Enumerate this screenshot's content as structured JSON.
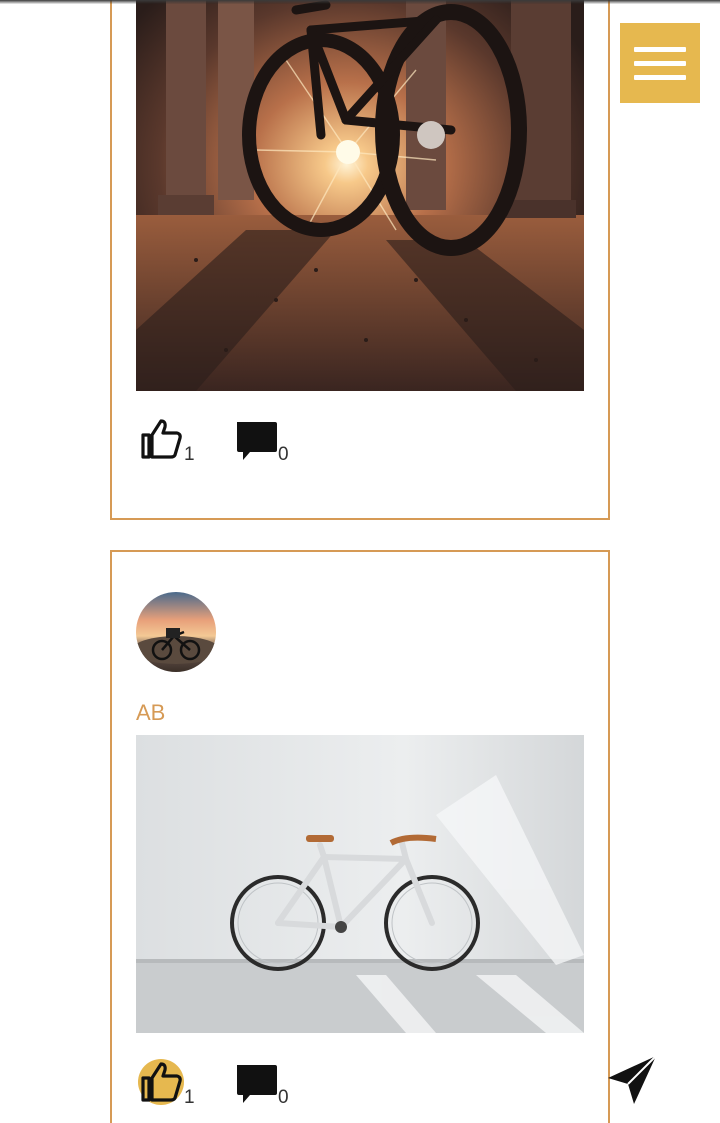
{
  "header": {
    "menu_icon": "hamburger-menu-icon",
    "accent_color": "#e6b84f"
  },
  "posts": [
    {
      "image_description_icon": "bicycle-sunset-photo",
      "likes": {
        "count": "1",
        "icon": "thumbs-up-icon",
        "active": false
      },
      "comments": {
        "count": "0",
        "icon": "comment-bubble-icon"
      }
    },
    {
      "author": {
        "name": "AB",
        "avatar_icon": "avatar-photo"
      },
      "image_description_icon": "white-bicycle-photo",
      "likes": {
        "count": "1",
        "icon": "thumbs-up-icon",
        "active": true
      },
      "comments": {
        "count": "0",
        "icon": "comment-bubble-icon"
      }
    }
  ],
  "fab": {
    "icon": "send-icon"
  },
  "colors": {
    "card_border": "#d69a55",
    "author_name": "#d69a55",
    "like_active_bg": "#e6b84f"
  }
}
